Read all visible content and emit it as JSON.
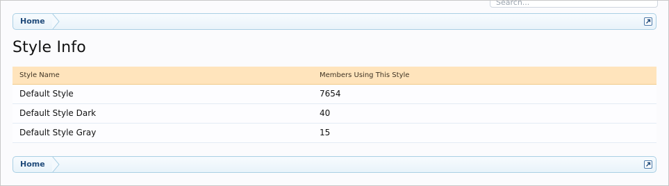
{
  "search": {
    "value": "Search..."
  },
  "breadcrumb": {
    "home_label": "Home"
  },
  "page": {
    "title": "Style Info"
  },
  "table": {
    "columns": [
      "Style Name",
      "Members Using This Style"
    ],
    "rows": [
      {
        "name": "Default Style",
        "members": "7654"
      },
      {
        "name": "Default Style Dark",
        "members": "40"
      },
      {
        "name": "Default Style Gray",
        "members": "15"
      }
    ]
  },
  "colors": {
    "header_bg": "#ffe4bc",
    "breadcrumb_border": "#a9cfe4",
    "link": "#1f4a7a"
  },
  "icons": {
    "jump": "external-link-icon",
    "crumb_separator": "chevron-right-icon"
  }
}
